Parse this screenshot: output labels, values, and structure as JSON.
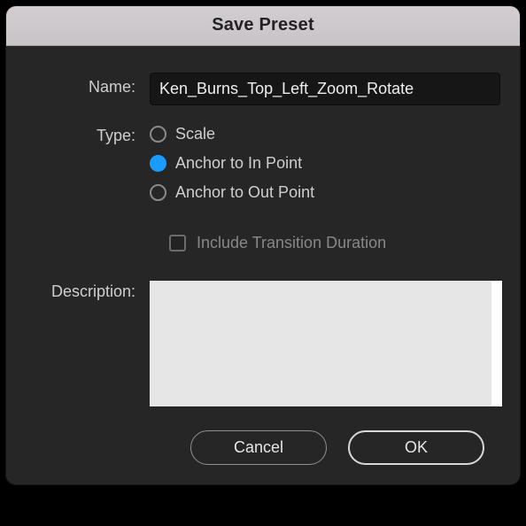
{
  "title": "Save Preset",
  "labels": {
    "name": "Name:",
    "type": "Type:",
    "description": "Description:"
  },
  "name_value": "Ken_Burns_Top_Left_Zoom_Rotate",
  "type_options": {
    "scale": "Scale",
    "anchor_in": "Anchor to In Point",
    "anchor_out": "Anchor to Out Point"
  },
  "checkbox_label": "Include Transition Duration",
  "description_value": "",
  "buttons": {
    "cancel": "Cancel",
    "ok": "OK"
  }
}
